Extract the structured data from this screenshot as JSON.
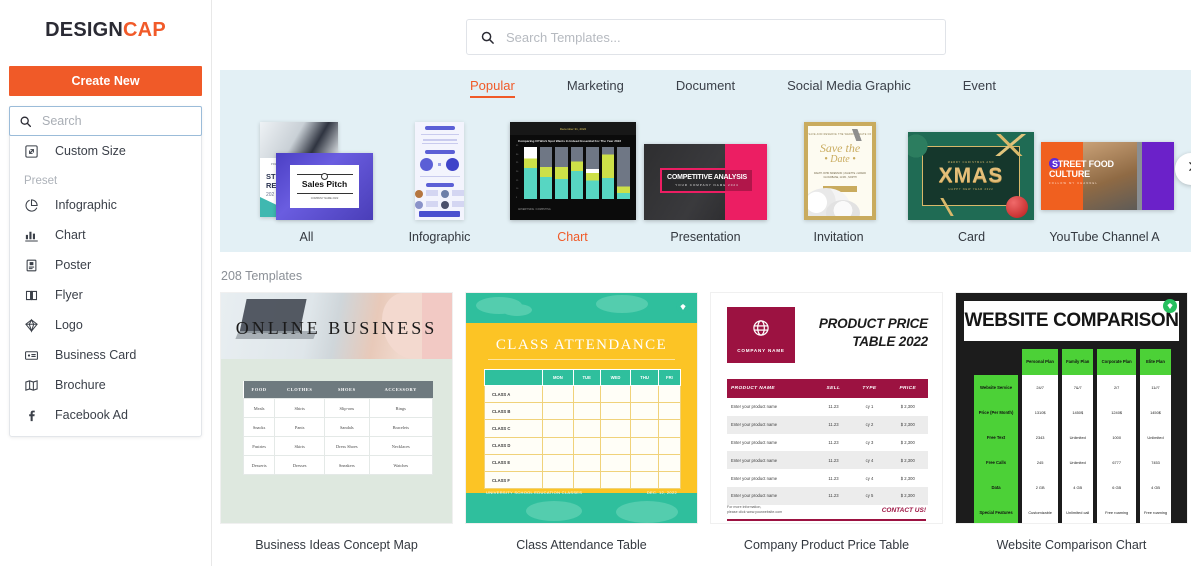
{
  "brand": {
    "name_dark": "DESIGN",
    "name_accent": "CAP",
    "accent_color": "#f05a28"
  },
  "sidebar": {
    "create_button": "Create New",
    "search_placeholder": "Search",
    "search_value": "",
    "custom_size": "Custom Size",
    "preset_label": "Preset",
    "items": [
      {
        "label": "Infographic",
        "icon": "pie-chart-icon"
      },
      {
        "label": "Chart",
        "icon": "bar-chart-icon"
      },
      {
        "label": "Poster",
        "icon": "poster-icon"
      },
      {
        "label": "Flyer",
        "icon": "flyer-icon"
      },
      {
        "label": "Logo",
        "icon": "diamond-logo-icon"
      },
      {
        "label": "Business Card",
        "icon": "business-card-icon"
      },
      {
        "label": "Brochure",
        "icon": "brochure-icon"
      },
      {
        "label": "Facebook Ad",
        "icon": "facebook-icon"
      }
    ]
  },
  "header": {
    "search_placeholder": "Search Templates...",
    "search_value": ""
  },
  "carousel": {
    "tabs": [
      {
        "label": "Popular",
        "active": true
      },
      {
        "label": "Marketing",
        "active": false
      },
      {
        "label": "Document",
        "active": false
      },
      {
        "label": "Social Media Graphic",
        "active": false
      },
      {
        "label": "Event",
        "active": false
      }
    ],
    "categories": [
      {
        "label": "All",
        "active": false
      },
      {
        "label": "Infographic",
        "active": false
      },
      {
        "label": "Chart",
        "active": true
      },
      {
        "label": "Presentation",
        "active": false
      },
      {
        "label": "Invitation",
        "active": false
      },
      {
        "label": "Card",
        "active": false
      },
      {
        "label": "YouTube Channel A",
        "active": false
      }
    ],
    "next_icon": "chevron-right-icon",
    "bg_color": "#e3f0f5"
  },
  "templates": {
    "count_label": "208 Templates",
    "cards": [
      {
        "caption": "Business Ideas Concept Map"
      },
      {
        "caption": "Class Attendance Table"
      },
      {
        "caption": "Company Product Price Table"
      },
      {
        "caption": "Website Comparison Chart"
      }
    ]
  },
  "thumb_all": {
    "back_title_1": "STUDENT AID",
    "back_title_2": "RE",
    "back_year": "202",
    "front_title": "Sales Pitch",
    "front_sub": "COMPANY NAME 2022"
  },
  "thumb_chart": {
    "title": "Comparing Of Work Spot Wants In Indeed Essential For The Year 2022",
    "footer": "ADVERTISING / COMPUTING"
  },
  "thumb_presentation": {
    "title": "COMPETITIVE ANALYSIS",
    "subtitle": "YOUR COMPANY NAME 2024"
  },
  "thumb_invitation": {
    "top_line": "SAVE AND RESERVE THE WEDDING DATE OF",
    "title_1": "Save the",
    "title_2": "• Date •",
    "lines": "RALPH JOHN SWENSON  |  JULIETTE  •  GRAND CLOUDBASE, 11 RD., NORTH"
  },
  "thumb_card": {
    "top": "MERRY CHRISTMAS AND",
    "title": "XMAS",
    "bottom": "HAPPY NEW YEAR 2022"
  },
  "thumb_youtube": {
    "title_1": "STREET FOOD",
    "title_2": "CULTURE",
    "sub": "FOLLOW MY CHANNEL"
  },
  "card1": {
    "title": "ONLINE BUSINESS",
    "headers": [
      "FOOD",
      "CLOTHES",
      "SHOES",
      "ACCESSORY"
    ],
    "rows": [
      [
        "Meals",
        "Shirts",
        "Slip-ons",
        "Rings"
      ],
      [
        "Snacks",
        "Pants",
        "Sandals",
        "Bracelets"
      ],
      [
        "Pastries",
        "Skirts",
        "Dress Shoes",
        "Necklaces"
      ],
      [
        "Desserts",
        "Dresses",
        "Sneakers",
        "Watches"
      ]
    ]
  },
  "card2": {
    "title": "CLASS ATTENDANCE",
    "headers": [
      "",
      "MON",
      "TUE",
      "WED",
      "THU",
      "FRI"
    ],
    "rows": [
      "CLASS A",
      "CLASS B",
      "CLASS C",
      "CLASS D",
      "CLASS E",
      "CLASS F"
    ],
    "footer_left": "UNIVERSITY SCHOOL EDUCATION CLASSES",
    "footer_right": "DEC. 12, 2022",
    "badge_icon": "diamond-badge-icon"
  },
  "card3": {
    "company_name": "COMPANY NAME",
    "company_icon": "globe-icon",
    "title_1": "PRODUCT PRICE",
    "title_2": "TABLE 2022",
    "headers": [
      "PRODUCT NAME",
      "SELL",
      "TYPE",
      "PRICE"
    ],
    "rows": [
      [
        "Enter your product name",
        "11.23",
        "cy 1",
        "$ 2,300"
      ],
      [
        "Enter your product name",
        "11.23",
        "cy 2",
        "$ 2,300"
      ],
      [
        "Enter your product name",
        "11.23",
        "cy 3",
        "$ 2,300"
      ],
      [
        "Enter your product name",
        "11.23",
        "cy 4",
        "$ 2,300"
      ],
      [
        "Enter your product name",
        "11.23",
        "cy 4",
        "$ 2,300"
      ],
      [
        "Enter your product name",
        "11.23",
        "cy 5",
        "$ 2,300"
      ]
    ],
    "note_1": "For more information,",
    "note_2": "please click www.yourwebsite.com",
    "contact": "CONTACT US!"
  },
  "card4": {
    "title": "WEBSITE COMPARISON",
    "badge_icon": "diamond-badge-icon",
    "headers": [
      "",
      "Personal Plan",
      "Family Plan",
      "Corporate Plan",
      "Elite Plan"
    ],
    "rows": [
      [
        "Website Service",
        "24/7",
        "7&/7",
        "2/7",
        "11//7"
      ],
      [
        "Price (Per Month)",
        "1310$",
        "1450$",
        "1240$",
        "1450$"
      ],
      [
        "Free Text",
        "2343",
        "Unlimited",
        "1000",
        "Unlimited"
      ],
      [
        "Free Calls",
        "245",
        "Unlimited",
        "6777",
        "7453"
      ],
      [
        "Data",
        "2 GB",
        "4 GB",
        "6 GB",
        "4 GB"
      ],
      [
        "Special Features",
        "Customizable",
        "Unlimited call",
        "Free roaming",
        "Free roaming"
      ]
    ]
  }
}
